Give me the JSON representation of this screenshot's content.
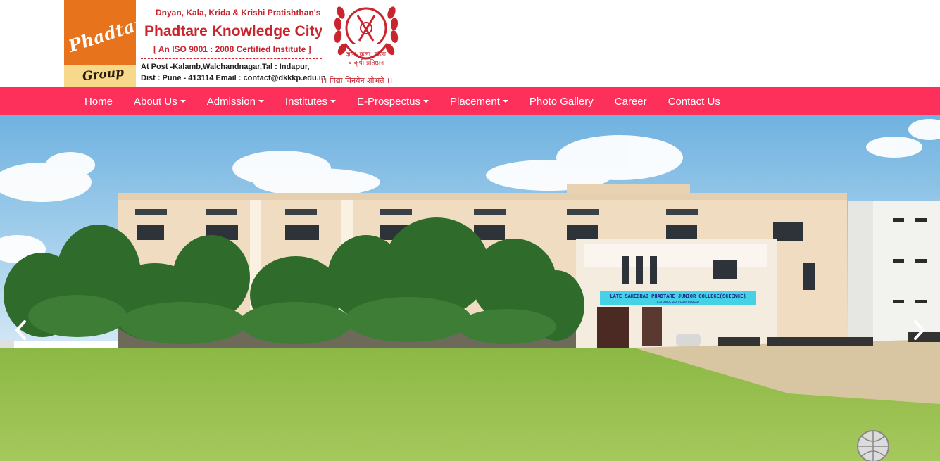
{
  "header": {
    "logo": {
      "script_text": "Phadtare",
      "group_text": "Group"
    },
    "org_line1": "Dnyan, Kala, Krida & Krishi Pratishthan's",
    "org_title": "Phadtare Knowledge City",
    "iso_line": "[ An ISO 9001 : 2008 Certified Institute ]",
    "address_line1": "At Post -Kalamb,Walchandnagar,Tal : Indapur,",
    "address_line2": "Dist : Pune - 413114 Email : contact@dkkkp.edu.in",
    "emblem_text_1": "ज्ञान, कला, क्रिडा",
    "emblem_text_2": "व कृषी प्रतिष्ठान",
    "motto": "।। विद्या विनयेन शोभते ।।"
  },
  "nav": {
    "items": [
      {
        "label": "Home",
        "dropdown": false
      },
      {
        "label": "About Us",
        "dropdown": true
      },
      {
        "label": "Admission",
        "dropdown": true
      },
      {
        "label": "Institutes",
        "dropdown": true
      },
      {
        "label": "E-Prospectus",
        "dropdown": true
      },
      {
        "label": "Placement",
        "dropdown": true
      },
      {
        "label": "Photo Gallery",
        "dropdown": false
      },
      {
        "label": "Career",
        "dropdown": false
      },
      {
        "label": "Contact Us",
        "dropdown": false
      }
    ]
  },
  "carousel": {
    "signboard_line1": "LATE SAHEBRAO PHADTARE JUNIOR COLLEGE(SCIENCE)",
    "signboard_line2": "KALAMB-WALCHANDNAGAR",
    "prev_icon": "chevron-left-icon",
    "next_icon": "chevron-right-icon"
  },
  "colors": {
    "nav_bg": "#fd2f5b",
    "brand_red": "#c8252f",
    "logo_orange": "#e8731d",
    "sky": "#9fcbe8",
    "lawn": "#8fb84a"
  }
}
